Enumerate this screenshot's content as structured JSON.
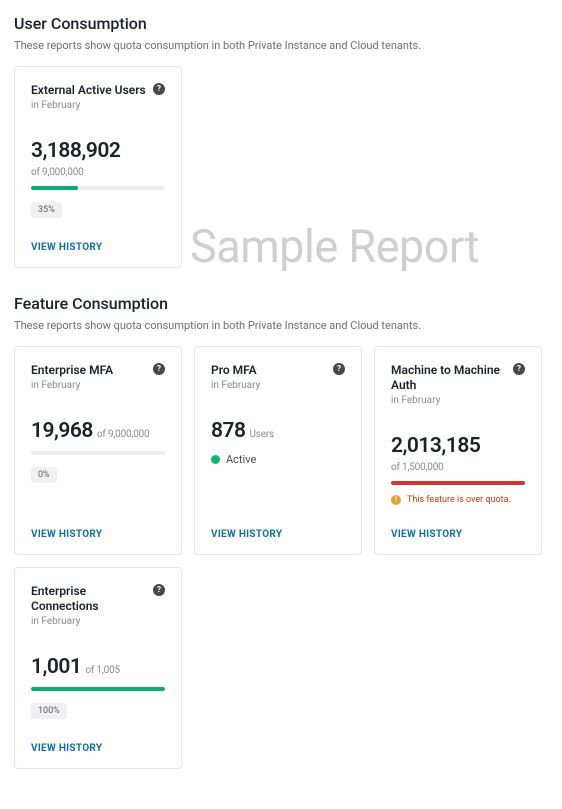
{
  "watermark": "Sample Report",
  "view_history_label": "VIEW HISTORY",
  "sections": {
    "user": {
      "title": "User Consumption",
      "desc": "These reports show quota consumption in both Private Instance and Cloud tenants."
    },
    "feature": {
      "title": "Feature Consumption",
      "desc": "These reports show quota consumption in both Private Instance and Cloud tenants."
    }
  },
  "cards": {
    "external_active_users": {
      "title": "External Active Users",
      "period": "in February",
      "value": "3,188,902",
      "of": "of 9,000,000",
      "pct": 35,
      "pct_label": "35%"
    },
    "enterprise_mfa": {
      "title": "Enterprise MFA",
      "period": "in February",
      "value": "19,968",
      "of": "of 9,000,000",
      "pct": 0,
      "pct_label": "0%"
    },
    "pro_mfa": {
      "title": "Pro MFA",
      "period": "in February",
      "value": "878",
      "unit": "Users",
      "status": "Active"
    },
    "m2m_auth": {
      "title": "Machine to Machine Auth",
      "period": "in February",
      "value": "2,013,185",
      "of": "of 1,500,000",
      "pct": 100,
      "warning": "This feature is over quota."
    },
    "enterprise_connections": {
      "title": "Enterprise Connections",
      "period": "in February",
      "value": "1,001",
      "of": "of 1,005",
      "pct": 100,
      "pct_label": "100%"
    }
  }
}
